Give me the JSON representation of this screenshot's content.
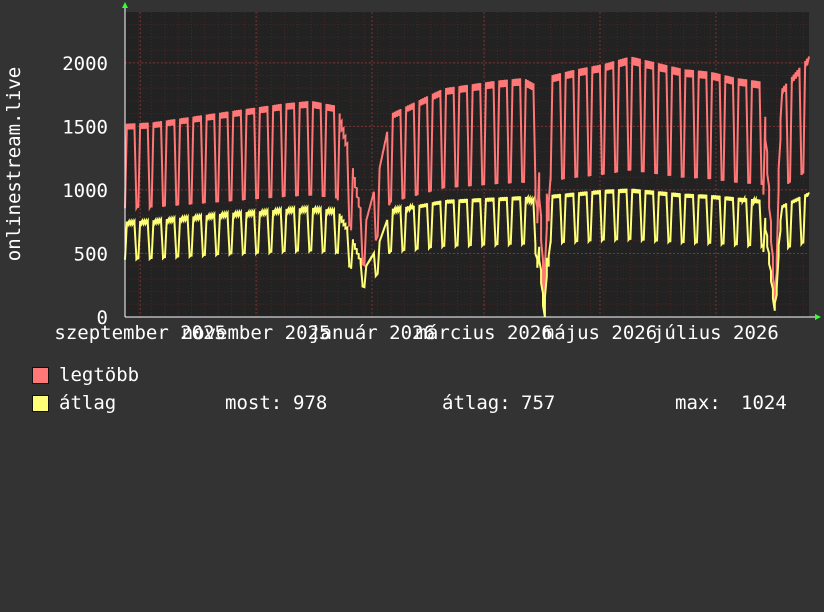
{
  "chart_data": {
    "type": "line",
    "ylabel": "onlinestream.live",
    "ylim": [
      0,
      2400
    ],
    "yticks": [
      0,
      500,
      1000,
      1500,
      2000
    ],
    "x_range": [
      "2025-08-24",
      "2026-08-19"
    ],
    "x_tick_labels": [
      {
        "label": "szeptember 2025",
        "date": "2025-09-01"
      },
      {
        "label": "november 2025",
        "date": "2025-11-01"
      },
      {
        "label": "január 2026",
        "date": "2026-01-01"
      },
      {
        "label": "március 2026",
        "date": "2026-03-01"
      },
      {
        "label": "május 2026",
        "date": "2026-05-01"
      },
      {
        "label": "július 2026",
        "date": "2026-07-01"
      }
    ],
    "grid": true,
    "series": [
      {
        "name": "legtöbb",
        "color": "#ff7777",
        "x": [
          "2025-08-24",
          "2025-09-07",
          "2025-09-21",
          "2025-10-05",
          "2025-10-19",
          "2025-11-02",
          "2025-11-16",
          "2025-11-30",
          "2025-12-14",
          "2025-12-21",
          "2025-12-28",
          "2026-01-04",
          "2026-01-11",
          "2026-01-25",
          "2026-02-08",
          "2026-02-22",
          "2026-03-08",
          "2026-03-22",
          "2026-03-28",
          "2026-04-02",
          "2026-04-05",
          "2026-04-19",
          "2026-05-03",
          "2026-05-17",
          "2026-05-31",
          "2026-06-14",
          "2026-06-28",
          "2026-07-12",
          "2026-07-26",
          "2026-08-01",
          "2026-08-05",
          "2026-08-19"
        ],
        "values": [
          1520,
          1530,
          1560,
          1590,
          1620,
          1650,
          1680,
          1700,
          1660,
          1250,
          700,
          1100,
          1600,
          1700,
          1800,
          1830,
          1860,
          1880,
          1830,
          100,
          1900,
          1950,
          1990,
          2050,
          2000,
          1950,
          1930,
          1880,
          1850,
          200,
          1800,
          2050
        ]
      },
      {
        "name": "átlag",
        "color": "#ffff77",
        "x": [
          "2025-08-24",
          "2025-09-07",
          "2025-09-21",
          "2025-10-05",
          "2025-10-19",
          "2025-11-02",
          "2025-11-16",
          "2025-11-30",
          "2025-12-14",
          "2025-12-21",
          "2025-12-28",
          "2026-01-04",
          "2026-01-11",
          "2026-01-25",
          "2026-02-08",
          "2026-02-22",
          "2026-03-08",
          "2026-03-22",
          "2026-03-28",
          "2026-04-02",
          "2026-04-05",
          "2026-04-19",
          "2026-05-03",
          "2026-05-17",
          "2026-05-31",
          "2026-06-14",
          "2026-06-28",
          "2026-07-12",
          "2026-07-26",
          "2026-08-01",
          "2026-08-05",
          "2026-08-19"
        ],
        "values": [
          750,
          760,
          780,
          800,
          820,
          830,
          850,
          860,
          840,
          650,
          380,
          550,
          850,
          880,
          920,
          930,
          940,
          950,
          920,
          0,
          960,
          980,
          1000,
          1010,
          990,
          970,
          960,
          940,
          920,
          80,
          880,
          980
        ]
      }
    ]
  },
  "legend": {
    "max_series": "legtöbb",
    "avg_series": "átlag",
    "now_label": "most:",
    "now_value": "978",
    "avg_label": "átlag:",
    "avg_value": "757",
    "max_label": "max:",
    "max_value": "1024"
  },
  "colors": {
    "background": "#333333",
    "plot_bg": "#222222",
    "grid": "#5a2a2a",
    "axis": "#ffffff"
  }
}
